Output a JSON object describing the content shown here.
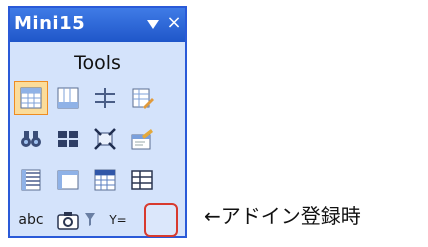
{
  "palette": {
    "title": "Mini15",
    "close_glyph": "×",
    "header": "Tools",
    "rows": [
      [
        {
          "icon": "table-grid-icon",
          "selected": true
        },
        {
          "icon": "table-columns-icon"
        },
        {
          "icon": "cross-lines-icon"
        },
        {
          "icon": "table-edit-icon"
        }
      ],
      [
        {
          "icon": "binoculars-icon"
        },
        {
          "icon": "split-view-icon"
        },
        {
          "icon": "resize-icon"
        },
        {
          "icon": "properties-icon"
        }
      ],
      [
        {
          "icon": "form-layout-icon"
        },
        {
          "icon": "frame-icon"
        },
        {
          "icon": "grid-data-icon"
        },
        {
          "icon": "list-table-icon"
        }
      ],
      [
        {
          "icon": "abc-spell-icon",
          "label": "abc"
        },
        {
          "icon": "camera-icon"
        },
        {
          "icon": "filter-icon",
          "label": "Y="
        }
      ]
    ]
  },
  "annotation": "←アドイン登録時"
}
